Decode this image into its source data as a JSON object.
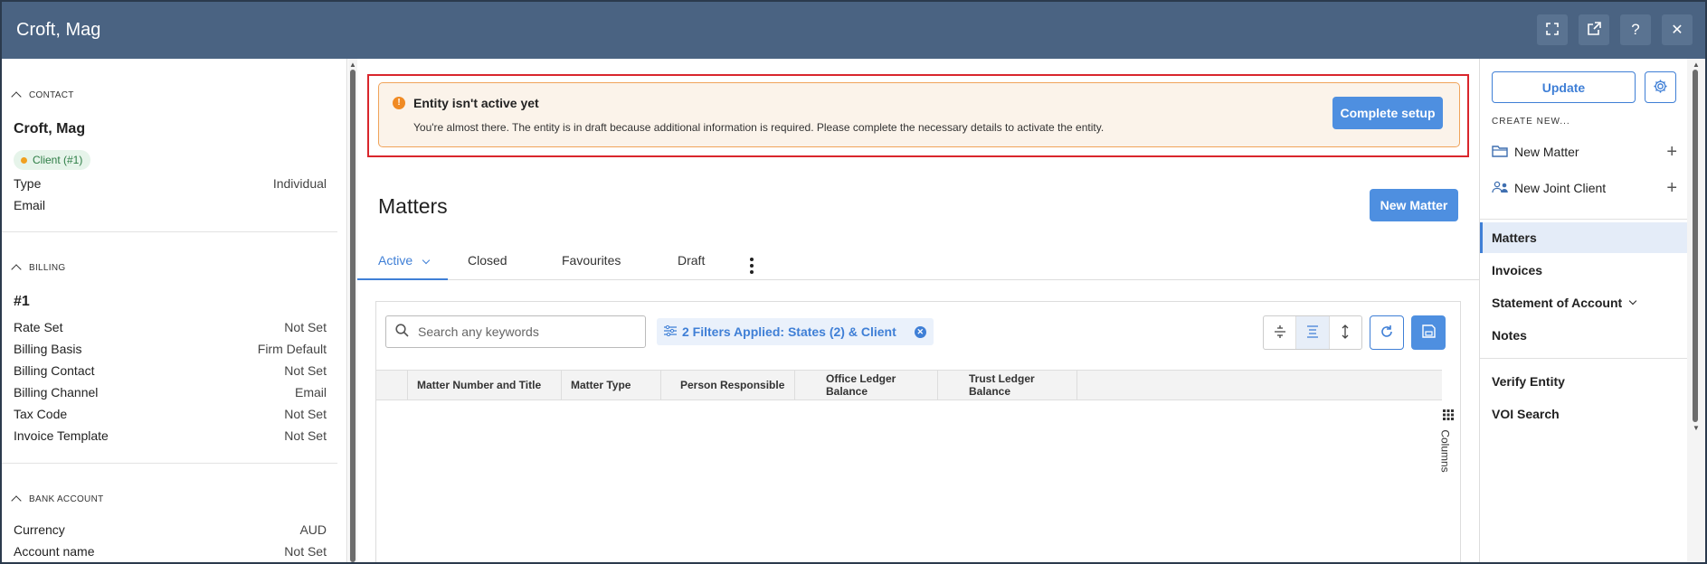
{
  "window": {
    "title": "Croft, Mag",
    "buttons": {
      "expand_icon": "expand-icon",
      "popout_icon": "external-link-icon",
      "help_label": "?",
      "close_label": "✕"
    }
  },
  "contact": {
    "section_label": "CONTACT",
    "name": "Croft, Mag",
    "badge": "Client (#1)",
    "rows": [
      {
        "key": "Type",
        "value": "Individual"
      },
      {
        "key": "Email",
        "value": ""
      }
    ]
  },
  "billing": {
    "section_label": "BILLING",
    "number": "#1",
    "rows": [
      {
        "key": "Rate Set",
        "value": "Not Set"
      },
      {
        "key": "Billing Basis",
        "value": "Firm Default"
      },
      {
        "key": "Billing Contact",
        "value": "Not Set"
      },
      {
        "key": "Billing Channel",
        "value": "Email"
      },
      {
        "key": "Tax Code",
        "value": "Not Set"
      },
      {
        "key": "Invoice Template",
        "value": "Not Set"
      }
    ]
  },
  "bank_account": {
    "section_label": "BANK ACCOUNT",
    "rows": [
      {
        "key": "Currency",
        "value": "AUD"
      },
      {
        "key": "Account name",
        "value": "Not Set"
      }
    ]
  },
  "alert": {
    "title": "Entity isn't active yet",
    "message": "You're almost there. The entity is in draft because additional information is required. Please complete the necessary details to activate the entity.",
    "button": "Complete setup",
    "icon_label": "!"
  },
  "matters": {
    "title": "Matters",
    "new_button": "New Matter",
    "tabs": [
      "Active",
      "Closed",
      "Favourites",
      "Draft"
    ],
    "search_placeholder": "Search any keywords",
    "filter_chip": "2 Filters Applied: States (2) & Client",
    "filter_clear": "✕",
    "columns": [
      "Matter Number and Title",
      "Matter Type",
      "Person Responsible",
      "Office Ledger Balance",
      "Trust Ledger Balance"
    ],
    "columns_side_label": "Columns"
  },
  "sidebar": {
    "update_button": "Update",
    "create_new_label": "CREATE NEW...",
    "create_items": [
      "New Matter",
      "New Joint Client"
    ],
    "plus": "+",
    "nav": [
      "Matters",
      "Invoices",
      "Statement of Account",
      "Notes"
    ],
    "actions": [
      "Verify Entity",
      "VOI Search"
    ]
  },
  "colors": {
    "header_bg": "#4a6382",
    "accent": "#3f7fd6",
    "primary_button": "#4e8fe0",
    "alert_border": "#f0a35a",
    "alert_bg": "#fbf3ea",
    "highlight_outline": "#d9262c",
    "badge_bg": "#e6f4ea",
    "badge_text": "#2d7d45"
  }
}
